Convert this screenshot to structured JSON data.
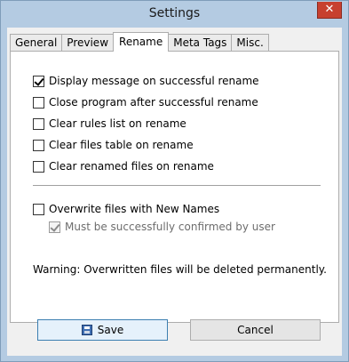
{
  "window": {
    "title": "Settings",
    "close_glyph": "✕"
  },
  "tabs": [
    {
      "label": "General",
      "active": false
    },
    {
      "label": "Preview",
      "active": false
    },
    {
      "label": "Rename",
      "active": true
    },
    {
      "label": "Meta Tags",
      "active": false
    },
    {
      "label": "Misc.",
      "active": false
    }
  ],
  "options": [
    {
      "label": "Display message on successful rename",
      "checked": true
    },
    {
      "label": "Close program after successful rename",
      "checked": false
    },
    {
      "label": "Clear rules list on rename",
      "checked": false
    },
    {
      "label": "Clear files table on rename",
      "checked": false
    },
    {
      "label": "Clear renamed files on rename",
      "checked": false
    }
  ],
  "overwrite": {
    "label": "Overwrite files with New Names",
    "checked": false,
    "confirm_label": "Must be successfully confirmed by user",
    "confirm_checked": true,
    "confirm_disabled": true,
    "warning": "Warning: Overwritten files will be deleted permanently."
  },
  "buttons": {
    "save_label": "Save",
    "cancel_label": "Cancel"
  },
  "icons": {
    "save": "floppy-disk-icon",
    "close": "close-icon"
  }
}
